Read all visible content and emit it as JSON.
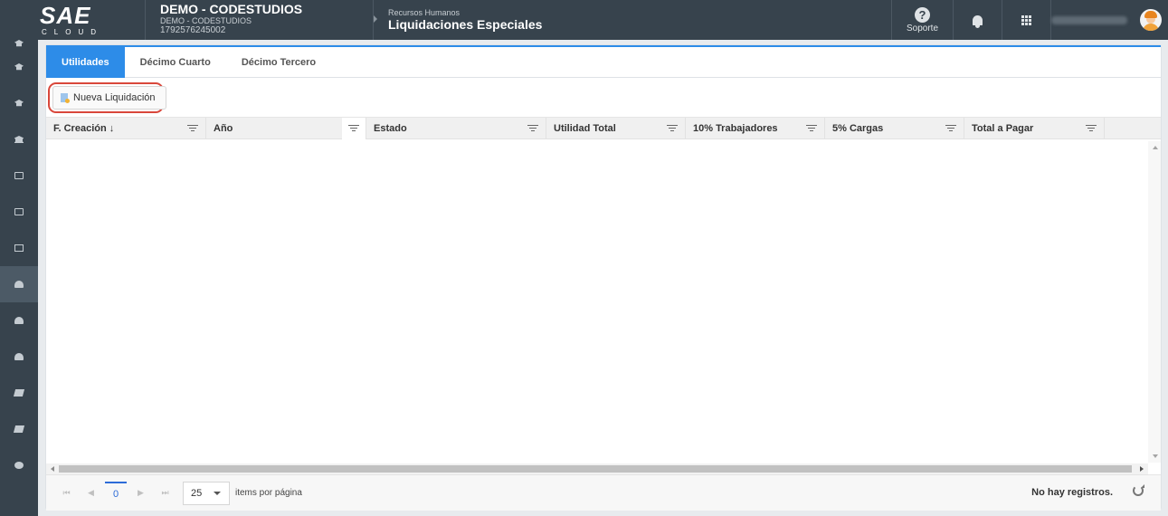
{
  "header": {
    "logo_text": "SAE",
    "logo_sub": "CLOUD",
    "company_name": "DEMO - CODESTUDIOS",
    "company_sub": "DEMO - CODESTUDIOS",
    "company_ruc": "1792576245002",
    "module_parent": "Recursos Humanos",
    "module_title": "Liquidaciones Especiales",
    "support_label": "Soporte",
    "support_glyph": "?"
  },
  "sidebar": {
    "items": [
      {
        "icon": "graduation-cap-icon"
      },
      {
        "icon": "graduation-cap-icon"
      },
      {
        "icon": "graduation-cap-icon"
      },
      {
        "icon": "bank-icon"
      },
      {
        "icon": "folder-open-icon"
      },
      {
        "icon": "folder-open-icon"
      },
      {
        "icon": "id-card-icon"
      },
      {
        "icon": "users-icon",
        "active": true
      },
      {
        "icon": "users-icon"
      },
      {
        "icon": "users-icon"
      },
      {
        "icon": "book-icon"
      },
      {
        "icon": "book-icon"
      },
      {
        "icon": "cogs-icon"
      }
    ]
  },
  "tabs": [
    {
      "label": "Utilidades",
      "active": true
    },
    {
      "label": "Décimo Cuarto"
    },
    {
      "label": "Décimo Tercero"
    }
  ],
  "toolbar": {
    "new_button_label": "Nueva Liquidación"
  },
  "grid": {
    "columns": [
      "F. Creación ↓",
      "Año",
      "Estado",
      "Utilidad Total",
      "10% Trabajadores",
      "5% Cargas",
      "Total a Pagar"
    ],
    "rows": []
  },
  "pager": {
    "current_page": "0",
    "page_size": "25",
    "page_size_label": "items por página",
    "info": "No hay registros.",
    "first_glyph": "⏮",
    "prev_glyph": "◀",
    "next_glyph": "▶",
    "last_glyph": "⏭"
  },
  "colors": {
    "topbar": "#37434d",
    "accent": "#2d8ce8",
    "highlight": "#d9473b"
  }
}
